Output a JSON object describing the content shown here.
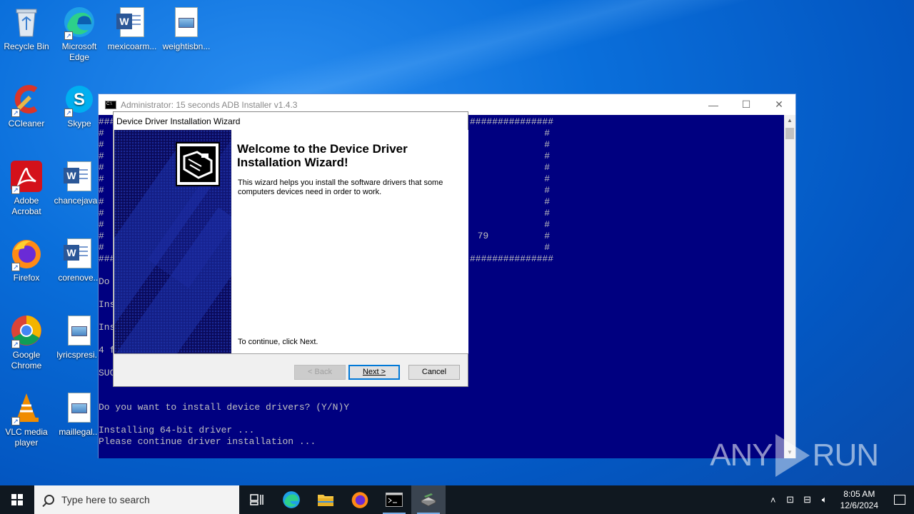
{
  "desktop": {
    "icons": [
      {
        "label": "Recycle Bin",
        "icon": "recycle-bin-icon"
      },
      {
        "label": "Microsoft Edge",
        "icon": "edge-icon"
      },
      {
        "label": "mexicoarm...",
        "icon": "word-doc-icon"
      },
      {
        "label": "weightisbn...",
        "icon": "image-file-icon"
      },
      {
        "label": "CCleaner",
        "icon": "ccleaner-icon"
      },
      {
        "label": "Skype",
        "icon": "skype-icon"
      },
      {
        "label": "Adobe Acrobat",
        "icon": "acrobat-icon"
      },
      {
        "label": "chancejava...",
        "icon": "word-doc-icon"
      },
      {
        "label": "Firefox",
        "icon": "firefox-icon"
      },
      {
        "label": "corenove...",
        "icon": "word-doc-icon"
      },
      {
        "label": "Google Chrome",
        "icon": "chrome-icon"
      },
      {
        "label": "lyricspresi...",
        "icon": "image-file-icon"
      },
      {
        "label": "VLC media player",
        "icon": "vlc-icon"
      },
      {
        "label": "maillegal...",
        "icon": "image-file-icon"
      }
    ]
  },
  "console": {
    "title": "Administrator:  15 seconds ADB Installer v1.4.3",
    "lines_left": [
      "###",
      "#",
      "#",
      "#",
      "#",
      "#",
      "#",
      "#",
      "#",
      "#",
      "#",
      "#",
      "###",
      "",
      "Do",
      "",
      "Ins",
      "",
      "Ins",
      "",
      "4 f",
      "",
      "SUC"
    ],
    "lines_right": [
      "###############",
      "#",
      "#",
      "#",
      "#",
      "#",
      "#",
      "#",
      "#",
      "#",
      "79          #",
      "#",
      "###############"
    ],
    "tail": [
      "Do you want to install device drivers? (Y/N)Y",
      "",
      "Installing 64-bit driver ...",
      "Please continue driver installation ..."
    ]
  },
  "wizard": {
    "title": "Device Driver Installation Wizard",
    "heading": "Welcome to the Device Driver Installation Wizard!",
    "description": "This wizard helps you install the software drivers that some computers devices need in order to work.",
    "continue_text": "To continue, click Next.",
    "back_label": "< Back",
    "next_label": "Next >",
    "cancel_label": "Cancel"
  },
  "taskbar": {
    "search_placeholder": "Type here to search",
    "time": "8:05 AM",
    "date": "12/6/2024"
  },
  "watermark": {
    "left": "ANY",
    "right": "RUN"
  }
}
